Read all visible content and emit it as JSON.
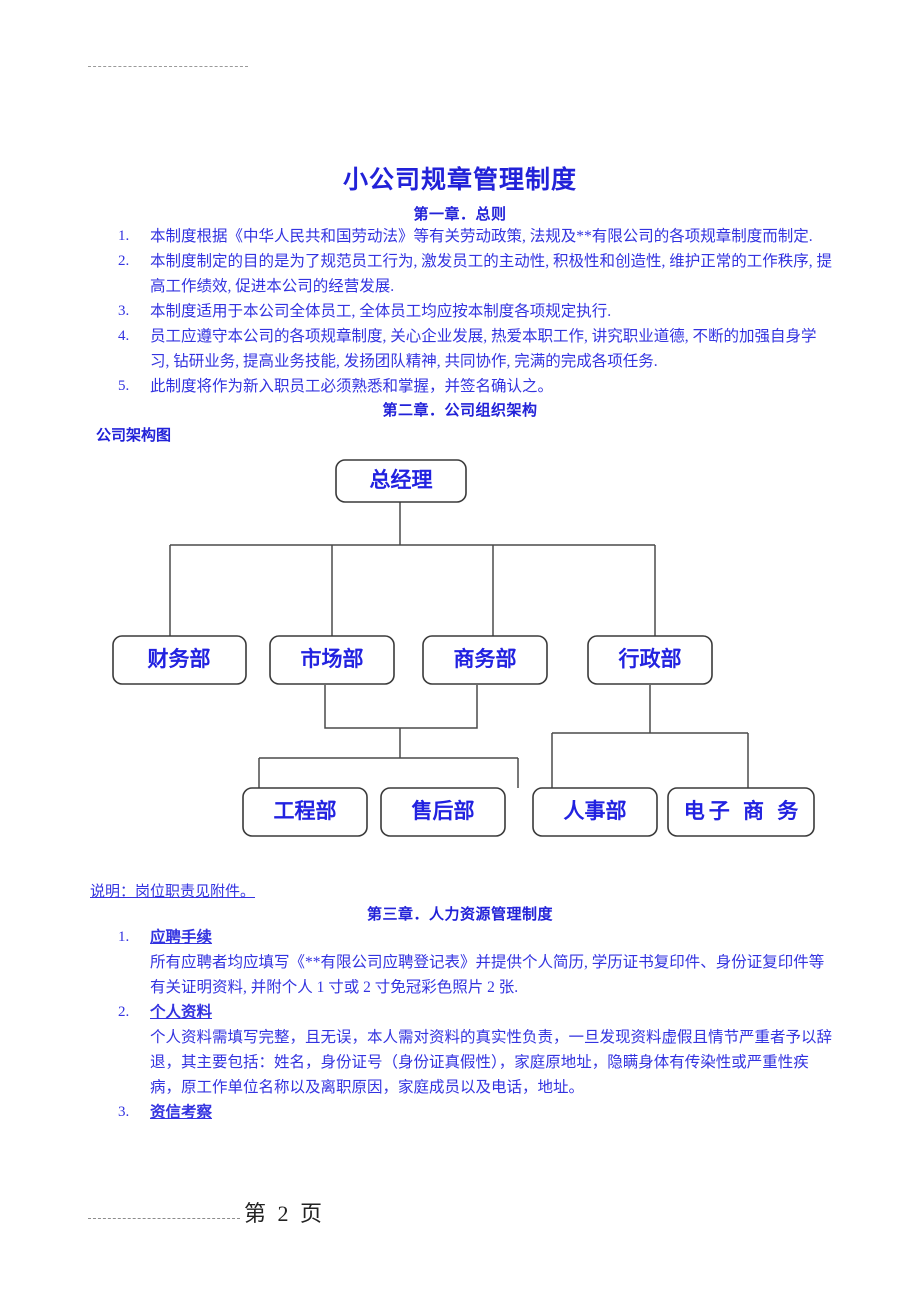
{
  "document": {
    "title": "小公司规章管理制度",
    "header_rule": "dashed-rule",
    "footer": {
      "page_label": "第  2  页"
    }
  },
  "chapter1": {
    "heading": "第一章．总则",
    "items": [
      {
        "num": "1.",
        "text": "本制度根据《中华人民共和国劳动法》等有关劳动政策, 法规及**有限公司的各项规章制度而制定."
      },
      {
        "num": "2.",
        "text": "本制度制定的目的是为了规范员工行为, 激发员工的主动性, 积极性和创造性, 维护正常的工作秩序, 提高工作绩效, 促进本公司的经营发展."
      },
      {
        "num": "3.",
        "text": "本制度适用于本公司全体员工, 全体员工均应按本制度各项规定执行."
      },
      {
        "num": "4.",
        "text": "员工应遵守本公司的各项规章制度, 关心企业发展, 热爱本职工作, 讲究职业道德, 不断的加强自身学习, 钻研业务, 提高业务技能, 发扬团队精神, 共同协作, 完满的完成各项任务."
      },
      {
        "num": "5.",
        "text": "此制度将作为新入职员工必须熟悉和掌握，并签名确认之。"
      }
    ]
  },
  "chapter2": {
    "heading": "第二章．公司组织架构",
    "sub_label": "公司架构图",
    "note": "说明：岗位职责见附件。",
    "org_chart": {
      "root": {
        "label": "总经理"
      },
      "level2": [
        {
          "label": "财务部"
        },
        {
          "label": "市场部"
        },
        {
          "label": "商务部"
        },
        {
          "label": "行政部"
        }
      ],
      "level3": [
        {
          "label": "工程部"
        },
        {
          "label": "售后部"
        },
        {
          "label": "人事部"
        },
        {
          "label": "电子 商 务"
        }
      ]
    }
  },
  "chapter3": {
    "heading": "第三章．人力资源管理制度",
    "items": [
      {
        "num": "1.",
        "head": "应聘手续",
        "body": "所有应聘者均应填写《**有限公司应聘登记表》并提供个人简历, 学历证书复印件、身份证复印件等有关证明资料, 并附个人 1 寸或 2 寸免冠彩色照片 2 张."
      },
      {
        "num": "2.",
        "head": "个人资料",
        "body": "个人资料需填写完整，且无误，本人需对资料的真实性负责，一旦发现资料虚假且情节严重者予以辞退，其主要包括：姓名，身份证号（身份证真假性），家庭原地址，隐瞒身体有传染性或严重性疾病，原工作单位名称以及离职原因，家庭成员以及电话，地址。"
      },
      {
        "num": "3.",
        "head": "资信考察",
        "body": ""
      }
    ]
  },
  "colors": {
    "text_blue": "#3333e0",
    "title_blue": "#2222d8",
    "line_gray": "#4a4a4a"
  }
}
